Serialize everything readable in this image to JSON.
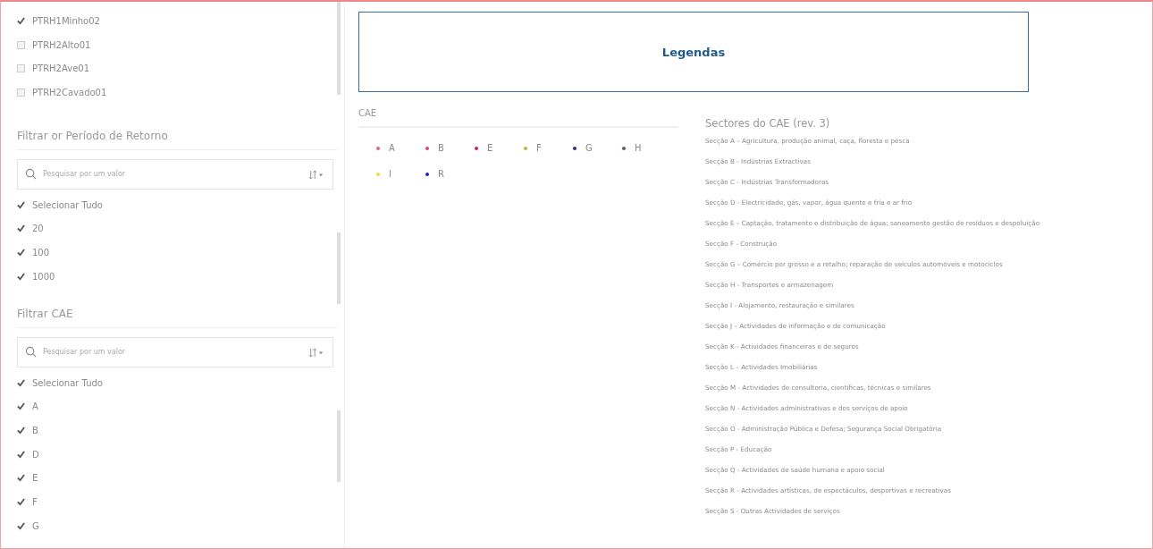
{
  "sidebar": {
    "top_list": [
      {
        "label": "PTRH1Minho02",
        "checked": true
      },
      {
        "label": "PTRH2Alto01",
        "checked": false
      },
      {
        "label": "PTRH2Ave01",
        "checked": false
      },
      {
        "label": "PTRH2Cavado01",
        "checked": false
      }
    ],
    "filters": [
      {
        "title": "Filtrar or Período de Retorno",
        "search": {
          "placeholder": "Pesquisar por um valor"
        },
        "items": [
          {
            "label": "Selecionar Tudo",
            "checked": true
          },
          {
            "label": "20",
            "checked": true
          },
          {
            "label": "100",
            "checked": true
          },
          {
            "label": "1000",
            "checked": true
          }
        ]
      },
      {
        "title": "Filtrar CAE",
        "search": {
          "placeholder": "Pesquisar por um valor"
        },
        "items": [
          {
            "label": "Selecionar Tudo",
            "checked": true
          },
          {
            "label": "A",
            "checked": true
          },
          {
            "label": "B",
            "checked": true
          },
          {
            "label": "D",
            "checked": true
          },
          {
            "label": "E",
            "checked": true
          },
          {
            "label": "F",
            "checked": true
          },
          {
            "label": "G",
            "checked": true
          }
        ]
      }
    ]
  },
  "legend_title": "Legendas",
  "cae_legend": {
    "title": "CAE",
    "items": [
      {
        "label": "A",
        "color": "#e0609a"
      },
      {
        "label": "B",
        "color": "#d04a80"
      },
      {
        "label": "E",
        "color": "#c02860"
      },
      {
        "label": "F",
        "color": "#c8b040"
      },
      {
        "label": "G",
        "color": "#2a2a9a"
      },
      {
        "label": "H",
        "color": "#5a5a7a"
      },
      {
        "label": "I",
        "color": "#e8e030"
      },
      {
        "label": "R",
        "color": "#2020c8"
      }
    ]
  },
  "sectors": {
    "title": "Sectores do CAE (rev. 3)",
    "items": [
      "Secção A – Agricultura, produção animal, caça, floresta e pesca",
      "Secção B - Indústrias Extractivas",
      "Secção C - Indústrias Transformadoras",
      "Secção D - Electricidade, gás, vapor, água quente e fria e ar frio",
      "Secção E – Captação, tratamento e distribuição de água; saneamento gestão de resíduos e despoluição",
      "Secção F - Construção",
      "Secção G – Comércio por grosso e a retalho; reparação de veículos automóveis e motociclos",
      "Secção H - Transportes e armazenagem",
      "Secção I - Alojamento, restauração e similares",
      "Secção J – Actividades de informação e de comunicação",
      "Secção K - Actividades financeiras e de seguros",
      "Secção L – Actividades Imobiliárias",
      "Secção M - Actividades de consultoria, científicas, técnicas e similares",
      "Secção N - Actividades administrativas e dos serviços de apoio",
      "Secção O - Administração Pública e Defesa; Segurança Social Obrigatória",
      "Secção P - Educação",
      "Secção Q - Actividades de saúde humana e apoio social",
      "Secção R - Actividades artísticas, de espectáculos, desportivas e recreativas",
      "Secção S - Outras Actividades de serviços"
    ]
  }
}
